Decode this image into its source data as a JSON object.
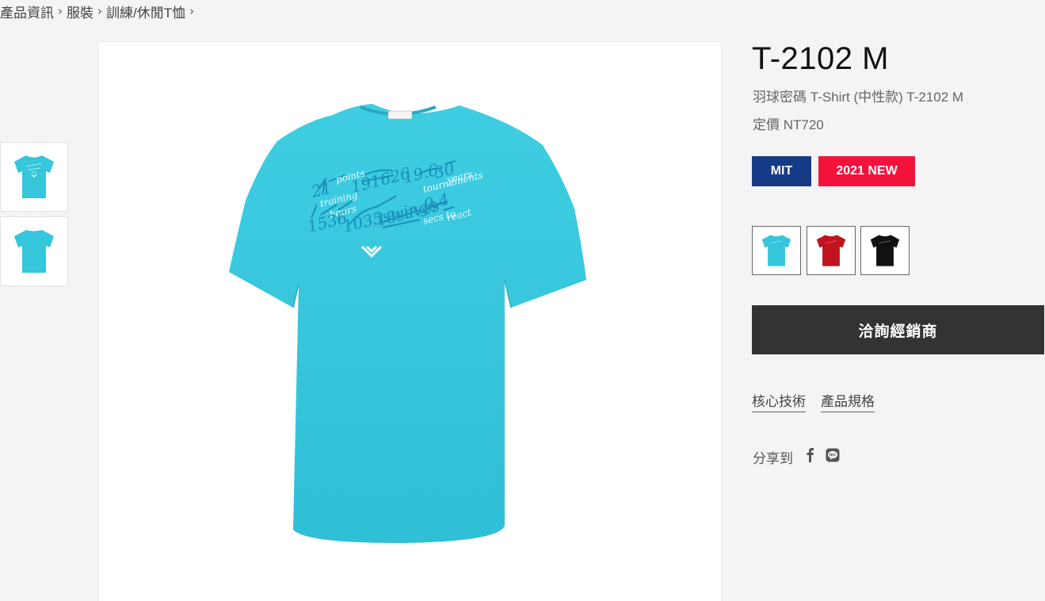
{
  "breadcrumb": {
    "items": [
      "產品資訊",
      "服裝",
      "訓練/休閒T恤"
    ]
  },
  "product": {
    "title": "T-2102 M",
    "subtitle": "羽球密碼 T-Shirt (中性款) T-2102 M",
    "price": "定價 NT720",
    "shirt_print_lines": [
      "21 points",
      "191626 km",
      "19.6",
      "30",
      "1536 training hours",
      "1035 swings",
      "18 saves",
      "0.4",
      "tournaments",
      "years",
      "secs to",
      "react"
    ]
  },
  "badges": {
    "mit": "MIT",
    "new": "2021 NEW"
  },
  "colors": {
    "badge_mit": "#163a86",
    "badge_new": "#f3123c",
    "button_bg": "#333333",
    "shirt_cyan": "#35c6dc",
    "shirt_red": "#c1121f",
    "shirt_black": "#111111"
  },
  "swatches": [
    "cyan",
    "red",
    "black"
  ],
  "actions": {
    "dealer_button": "洽詢經銷商"
  },
  "links": {
    "core_tech": "核心技術",
    "specs": "產品規格"
  },
  "share": {
    "label": "分享到",
    "icons": [
      "facebook-icon",
      "line-icon"
    ]
  }
}
